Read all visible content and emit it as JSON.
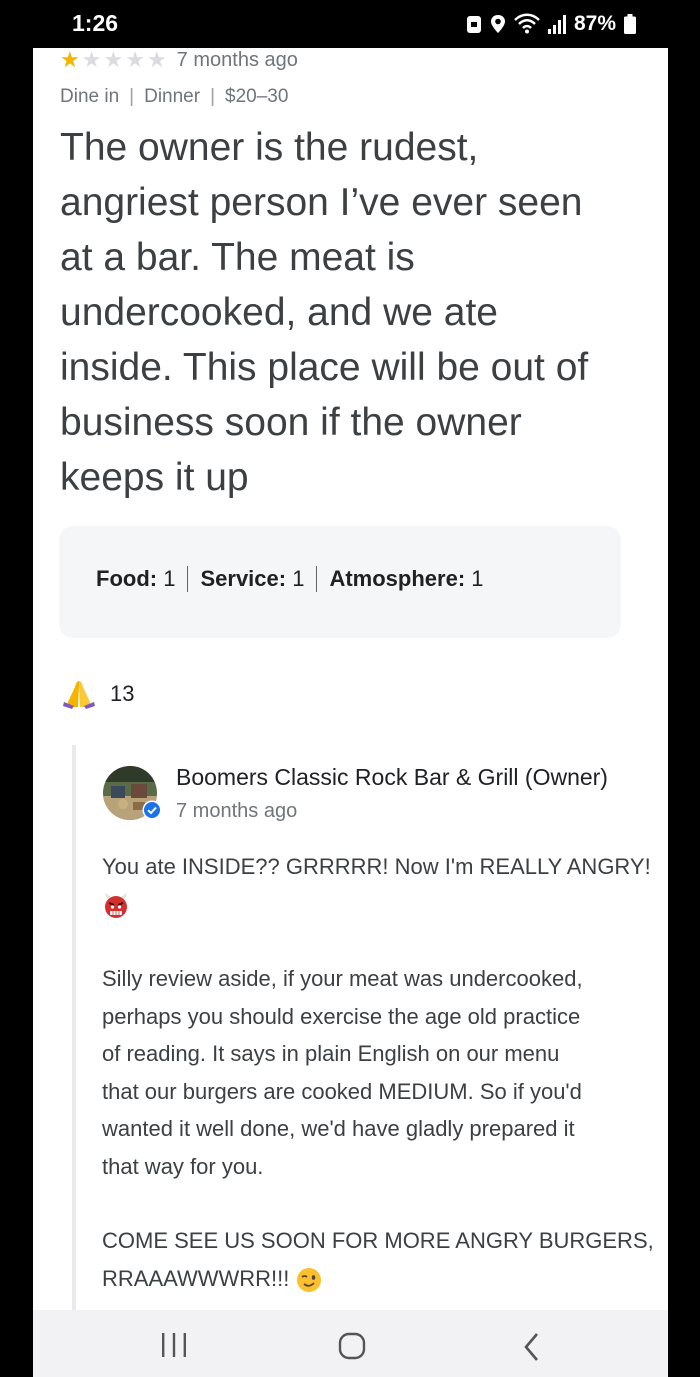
{
  "status_bar": {
    "time": "1:26",
    "battery": "87%",
    "icons": [
      "lock-icon",
      "location-icon",
      "wifi-icon",
      "signal-icon",
      "battery-icon"
    ]
  },
  "review": {
    "stars": 1,
    "max_stars": 5,
    "date": "7 months ago",
    "meta": [
      "Dine in",
      "Dinner",
      "$20–30"
    ],
    "text_lines": [
      "The owner is the rudest,",
      "angriest person I’ve ever seen",
      "at a bar. The meat is",
      "undercooked, and we ate",
      "inside. This place will be out of",
      "business soon if the owner",
      "keeps it up"
    ],
    "ratings": [
      {
        "label": "Food:",
        "value": "1"
      },
      {
        "label": "Service:",
        "value": "1"
      },
      {
        "label": "Atmosphere:",
        "value": "1"
      }
    ],
    "likes": "13"
  },
  "owner_response": {
    "name": "Boomers Classic Rock Bar & Grill (Owner)",
    "date": "7 months ago",
    "paragraph1": "You ate INSIDE?? GRRRRR! Now I'm REALLY ANGRY!",
    "paragraph2_lines": [
      "Silly review aside, if your meat was undercooked,",
      "perhaps you should exercise the age old practice",
      "of reading. It says in plain English on our menu",
      "that our burgers are cooked MEDIUM. So if you'd",
      "wanted it well done, we'd have gladly prepared it",
      "that way for you."
    ],
    "paragraph3_line1": "COME SEE US SOON FOR MORE ANGRY BURGERS,",
    "paragraph3_line2": "RRAAAWWWRR!!!"
  },
  "colors": {
    "star_on": "#f4b400",
    "star_off": "#dadce0",
    "text_primary": "#3c4043",
    "text_secondary": "#70757a",
    "verified_blue": "#1a73e8"
  },
  "nav_icons": [
    "recent-apps-icon",
    "home-icon",
    "back-icon"
  ]
}
